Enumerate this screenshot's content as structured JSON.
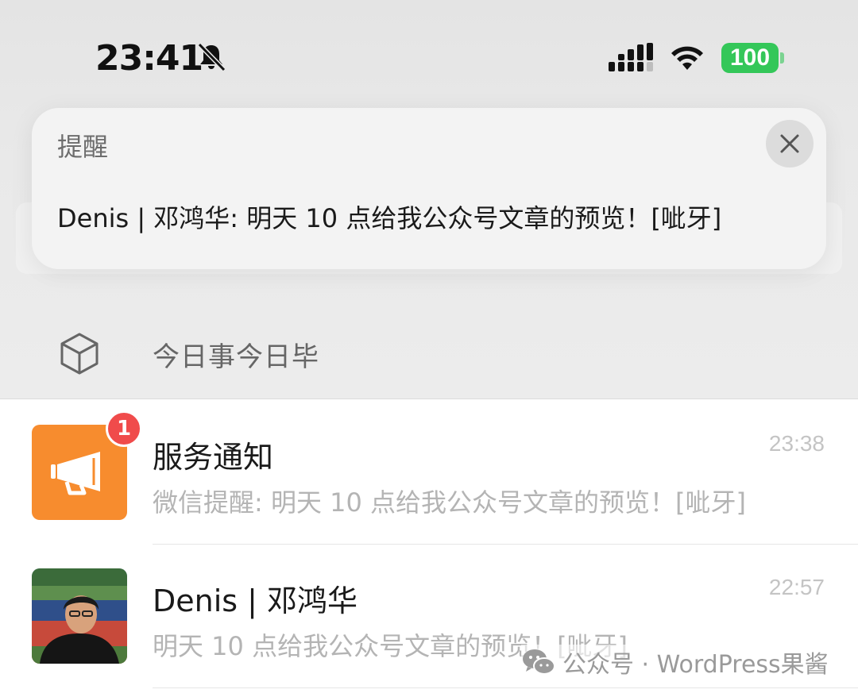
{
  "status_bar": {
    "time": "23:41",
    "battery": "100",
    "icons": [
      "bell-slash-icon",
      "cellular-signal-icon",
      "wifi-icon",
      "battery-icon"
    ]
  },
  "notification": {
    "title": "提醒",
    "message": "Denis | 邓鸿华: 明天 10 点给我公众号文章的预览！[呲牙]",
    "close_icon": "close-icon"
  },
  "today": {
    "label": "今日事今日毕",
    "icon": "cube-icon"
  },
  "chats": [
    {
      "name": "服务通知",
      "preview": "微信提醒: 明天 10 点给我公众号文章的预览！[呲牙]",
      "time": "23:38",
      "badge": "1",
      "avatar_icon": "megaphone-icon",
      "avatar_color": "#f78c2e"
    },
    {
      "name": "Denis | 邓鸿华",
      "preview": "明天 10 点给我公众号文章的预览！[呲牙]",
      "time": "22:57",
      "avatar_icon": "person-photo"
    }
  ],
  "watermark": {
    "text": "公众号 · WordPress果酱",
    "icon": "wechat-icon"
  },
  "colors": {
    "badge": "#f04b4b",
    "battery": "#34c759",
    "service_avatar": "#f78c2e"
  }
}
